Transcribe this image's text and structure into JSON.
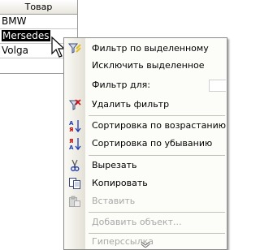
{
  "table": {
    "header": "Товар",
    "rows": [
      "BMW",
      "Mersedes",
      "Volga"
    ],
    "selected_row": 1
  },
  "menu": {
    "items": [
      {
        "label": "Фильтр по выделенному",
        "icon": "filter-by-selection-icon",
        "enabled": true
      },
      {
        "label": "Исключить выделенное",
        "icon": "",
        "enabled": true
      },
      {
        "label": "Фильтр для:",
        "icon": "",
        "enabled": true
      },
      {
        "label": "Удалить фильтр",
        "icon": "remove-filter-icon",
        "enabled": true
      },
      {
        "label": "Сортировка по возрастанию",
        "icon": "sort-ascending-icon",
        "enabled": true
      },
      {
        "label": "Сортировка по убыванию",
        "icon": "sort-descending-icon",
        "enabled": true
      },
      {
        "label": "Вырезать",
        "icon": "scissors-icon",
        "enabled": true
      },
      {
        "label": "Копировать",
        "icon": "copy-icon",
        "enabled": true
      },
      {
        "label": "Вставить",
        "icon": "paste-icon",
        "enabled": false
      },
      {
        "label": "Добавить объект...",
        "icon": "",
        "enabled": false
      },
      {
        "label": "Гиперссылка",
        "icon": "",
        "enabled": false
      }
    ],
    "has_more": true
  },
  "colors": {
    "selection_bg": "#000000",
    "menu_bg": "#fcfcf9",
    "disabled_text": "#a8a8a8",
    "sort_red": "#c00000",
    "sort_blue": "#1c3cb4"
  }
}
